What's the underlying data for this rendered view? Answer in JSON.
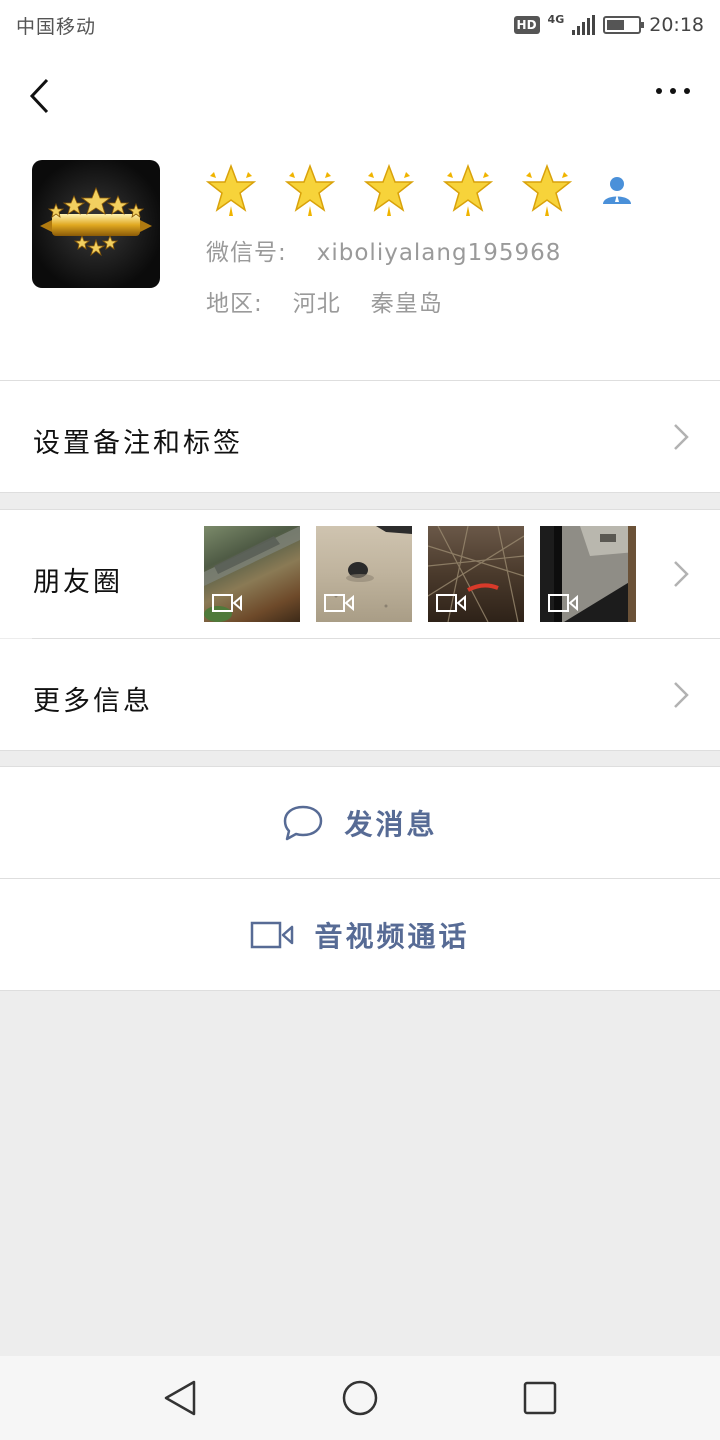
{
  "status_bar": {
    "carrier": "中国移动",
    "hd_badge": "HD",
    "network": "4G",
    "time": "20:18",
    "battery_level": 0.55
  },
  "profile": {
    "wechat_id_label": "微信号:",
    "wechat_id": "xiboliyalang195968",
    "region_label": "地区:",
    "region_province": "河北",
    "region_city": "秦皇岛",
    "star_count": 5
  },
  "menu": {
    "remarks_tags": "设置备注和标签",
    "moments": "朋友圈",
    "more_info": "更多信息"
  },
  "moments_thumbnails": [
    {
      "type": "video",
      "icon": "video-icon"
    },
    {
      "type": "video",
      "icon": "video-icon"
    },
    {
      "type": "video",
      "icon": "video-icon"
    },
    {
      "type": "video",
      "icon": "video-icon"
    }
  ],
  "actions": {
    "send_message": "发消息",
    "video_call": "音视频通话"
  },
  "colors": {
    "link_blue": "#576b95",
    "page_bg": "#ededed",
    "star_gold": "#f5c518",
    "person_blue": "#4a90d9"
  }
}
